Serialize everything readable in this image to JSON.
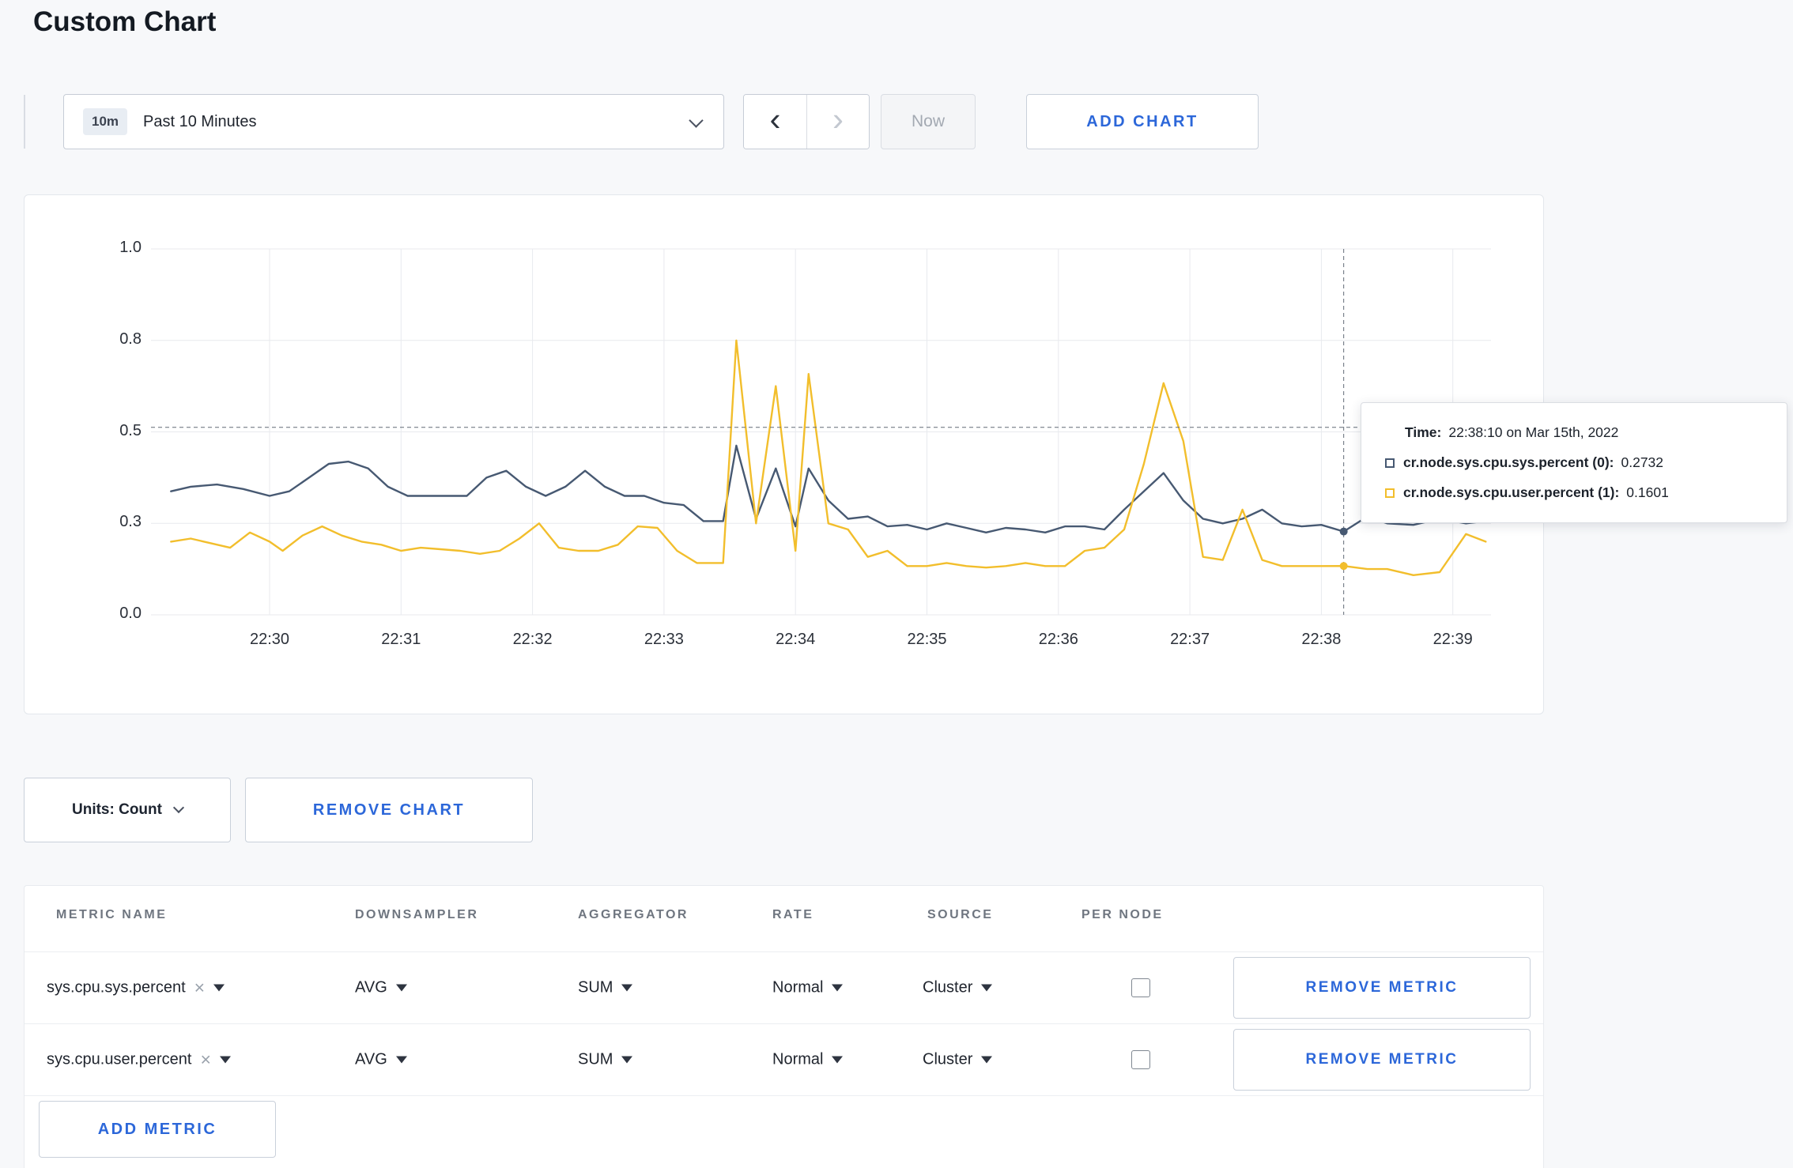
{
  "page": {
    "title": "Custom Chart",
    "accent_color": "#2c67d9",
    "background_color": "#f7f8fa"
  },
  "toolbar": {
    "time_range": {
      "badge": "10m",
      "label": "Past 10 Minutes"
    },
    "prev_icon": "‹",
    "next_icon": "›",
    "now_label": "Now",
    "add_chart_label": "ADD CHART"
  },
  "chart_data": {
    "type": "line",
    "title": "",
    "grid": true,
    "x_axis": {
      "ticks": [
        {
          "t": 30,
          "label": "22:30"
        },
        {
          "t": 31,
          "label": "22:31"
        },
        {
          "t": 32,
          "label": "22:32"
        },
        {
          "t": 33,
          "label": "22:33"
        },
        {
          "t": 34,
          "label": "22:34"
        },
        {
          "t": 35,
          "label": "22:35"
        },
        {
          "t": 36,
          "label": "22:36"
        },
        {
          "t": 37,
          "label": "22:37"
        },
        {
          "t": 38,
          "label": "22:38"
        },
        {
          "t": 39,
          "label": "22:39"
        }
      ]
    },
    "y_axis": {
      "ticks": [
        {
          "value": 0.0,
          "label": "0.0"
        },
        {
          "value": 0.3,
          "label": "0.3"
        },
        {
          "value": 0.5,
          "label": "0.5"
        },
        {
          "value": 0.8,
          "label": "0.8"
        },
        {
          "value": 1.0,
          "label": "1.0"
        }
      ]
    },
    "series": [
      {
        "name": "cr.node.sys.cpu.sys.percent",
        "color": "#475972",
        "points": [
          [
            29.25,
            0.37
          ],
          [
            29.4,
            0.38
          ],
          [
            29.6,
            0.385
          ],
          [
            29.8,
            0.375
          ],
          [
            30.0,
            0.36
          ],
          [
            30.15,
            0.37
          ],
          [
            30.3,
            0.4
          ],
          [
            30.45,
            0.43
          ],
          [
            30.6,
            0.435
          ],
          [
            30.75,
            0.42
          ],
          [
            30.9,
            0.38
          ],
          [
            31.05,
            0.36
          ],
          [
            31.2,
            0.36
          ],
          [
            31.35,
            0.36
          ],
          [
            31.5,
            0.36
          ],
          [
            31.65,
            0.4
          ],
          [
            31.8,
            0.415
          ],
          [
            31.95,
            0.38
          ],
          [
            32.1,
            0.36
          ],
          [
            32.25,
            0.38
          ],
          [
            32.4,
            0.415
          ],
          [
            32.55,
            0.38
          ],
          [
            32.7,
            0.36
          ],
          [
            32.85,
            0.36
          ],
          [
            33.0,
            0.345
          ],
          [
            33.15,
            0.34
          ],
          [
            33.3,
            0.305
          ],
          [
            33.45,
            0.305
          ],
          [
            33.55,
            0.47
          ],
          [
            33.7,
            0.31
          ],
          [
            33.85,
            0.42
          ],
          [
            34.0,
            0.29
          ],
          [
            34.1,
            0.42
          ],
          [
            34.25,
            0.35
          ],
          [
            34.4,
            0.31
          ],
          [
            34.55,
            0.315
          ],
          [
            34.7,
            0.29
          ],
          [
            34.85,
            0.295
          ],
          [
            35.0,
            0.28
          ],
          [
            35.15,
            0.3
          ],
          [
            35.3,
            0.285
          ],
          [
            35.45,
            0.27
          ],
          [
            35.6,
            0.285
          ],
          [
            35.75,
            0.28
          ],
          [
            35.9,
            0.27
          ],
          [
            36.05,
            0.29
          ],
          [
            36.2,
            0.29
          ],
          [
            36.35,
            0.28
          ],
          [
            36.5,
            0.33
          ],
          [
            36.65,
            0.37
          ],
          [
            36.8,
            0.41
          ],
          [
            36.95,
            0.35
          ],
          [
            37.1,
            0.31
          ],
          [
            37.25,
            0.3
          ],
          [
            37.4,
            0.31
          ],
          [
            37.55,
            0.33
          ],
          [
            37.7,
            0.3
          ],
          [
            37.85,
            0.29
          ],
          [
            38.0,
            0.295
          ],
          [
            38.17,
            0.2732
          ],
          [
            38.35,
            0.315
          ],
          [
            38.5,
            0.3
          ],
          [
            38.7,
            0.295
          ],
          [
            38.9,
            0.31
          ],
          [
            39.1,
            0.3
          ],
          [
            39.25,
            0.305
          ]
        ]
      },
      {
        "name": "cr.node.sys.cpu.user.percent",
        "color": "#f2be2c",
        "points": [
          [
            29.25,
            0.24
          ],
          [
            29.4,
            0.25
          ],
          [
            29.55,
            0.235
          ],
          [
            29.7,
            0.22
          ],
          [
            29.85,
            0.27
          ],
          [
            30.0,
            0.24
          ],
          [
            30.1,
            0.21
          ],
          [
            30.25,
            0.26
          ],
          [
            30.4,
            0.29
          ],
          [
            30.55,
            0.26
          ],
          [
            30.7,
            0.24
          ],
          [
            30.85,
            0.23
          ],
          [
            31.0,
            0.21
          ],
          [
            31.15,
            0.22
          ],
          [
            31.3,
            0.215
          ],
          [
            31.45,
            0.21
          ],
          [
            31.6,
            0.2
          ],
          [
            31.75,
            0.21
          ],
          [
            31.9,
            0.25
          ],
          [
            32.05,
            0.3
          ],
          [
            32.2,
            0.22
          ],
          [
            32.35,
            0.21
          ],
          [
            32.5,
            0.21
          ],
          [
            32.65,
            0.23
          ],
          [
            32.8,
            0.29
          ],
          [
            32.95,
            0.285
          ],
          [
            33.1,
            0.21
          ],
          [
            33.25,
            0.17
          ],
          [
            33.45,
            0.17
          ],
          [
            33.55,
            0.8
          ],
          [
            33.7,
            0.3
          ],
          [
            33.85,
            0.65
          ],
          [
            34.0,
            0.21
          ],
          [
            34.1,
            0.69
          ],
          [
            34.25,
            0.3
          ],
          [
            34.4,
            0.28
          ],
          [
            34.55,
            0.19
          ],
          [
            34.7,
            0.21
          ],
          [
            34.85,
            0.16
          ],
          [
            35.0,
            0.16
          ],
          [
            35.15,
            0.17
          ],
          [
            35.3,
            0.16
          ],
          [
            35.45,
            0.155
          ],
          [
            35.6,
            0.16
          ],
          [
            35.75,
            0.17
          ],
          [
            35.9,
            0.16
          ],
          [
            36.05,
            0.16
          ],
          [
            36.2,
            0.21
          ],
          [
            36.35,
            0.22
          ],
          [
            36.5,
            0.28
          ],
          [
            36.65,
            0.43
          ],
          [
            36.8,
            0.66
          ],
          [
            36.95,
            0.48
          ],
          [
            37.1,
            0.19
          ],
          [
            37.25,
            0.18
          ],
          [
            37.4,
            0.33
          ],
          [
            37.55,
            0.18
          ],
          [
            37.7,
            0.16
          ],
          [
            37.85,
            0.16
          ],
          [
            38.0,
            0.16
          ],
          [
            38.17,
            0.1601
          ],
          [
            38.35,
            0.15
          ],
          [
            38.5,
            0.15
          ],
          [
            38.7,
            0.13
          ],
          [
            38.9,
            0.14
          ],
          [
            39.1,
            0.265
          ],
          [
            39.25,
            0.24
          ]
        ]
      }
    ],
    "crosshair": {
      "t": 38.17,
      "hline_value": 0.515,
      "points": [
        {
          "series": "cr.node.sys.cpu.sys.percent",
          "value": 0.2732,
          "color": "#475972"
        },
        {
          "series": "cr.node.sys.cpu.user.percent",
          "value": 0.1601,
          "color": "#f2be2c"
        }
      ]
    }
  },
  "tooltip": {
    "time_label": "Time:",
    "time_value": "22:38:10 on Mar 15th, 2022",
    "rows": [
      {
        "label": "cr.node.sys.cpu.sys.percent (0):",
        "value": "0.2732",
        "color": "#475972"
      },
      {
        "label": "cr.node.sys.cpu.user.percent (1):",
        "value": "0.1601",
        "color": "#f2be2c"
      }
    ]
  },
  "controls": {
    "units_label": "Units: Count",
    "remove_chart_label": "REMOVE CHART",
    "add_metric_label": "ADD METRIC"
  },
  "table": {
    "headers": [
      "METRIC NAME",
      "DOWNSAMPLER",
      "AGGREGATOR",
      "RATE",
      "SOURCE",
      "PER NODE"
    ],
    "rows": [
      {
        "metric": "sys.cpu.sys.percent",
        "remove_chip": "×",
        "downsampler": "AVG",
        "aggregator": "SUM",
        "rate": "Normal",
        "source": "Cluster",
        "per_node_checked": false,
        "remove_label": "REMOVE METRIC"
      },
      {
        "metric": "sys.cpu.user.percent",
        "remove_chip": "×",
        "downsampler": "AVG",
        "aggregator": "SUM",
        "rate": "Normal",
        "source": "Cluster",
        "per_node_checked": false,
        "remove_label": "REMOVE METRIC"
      }
    ]
  }
}
